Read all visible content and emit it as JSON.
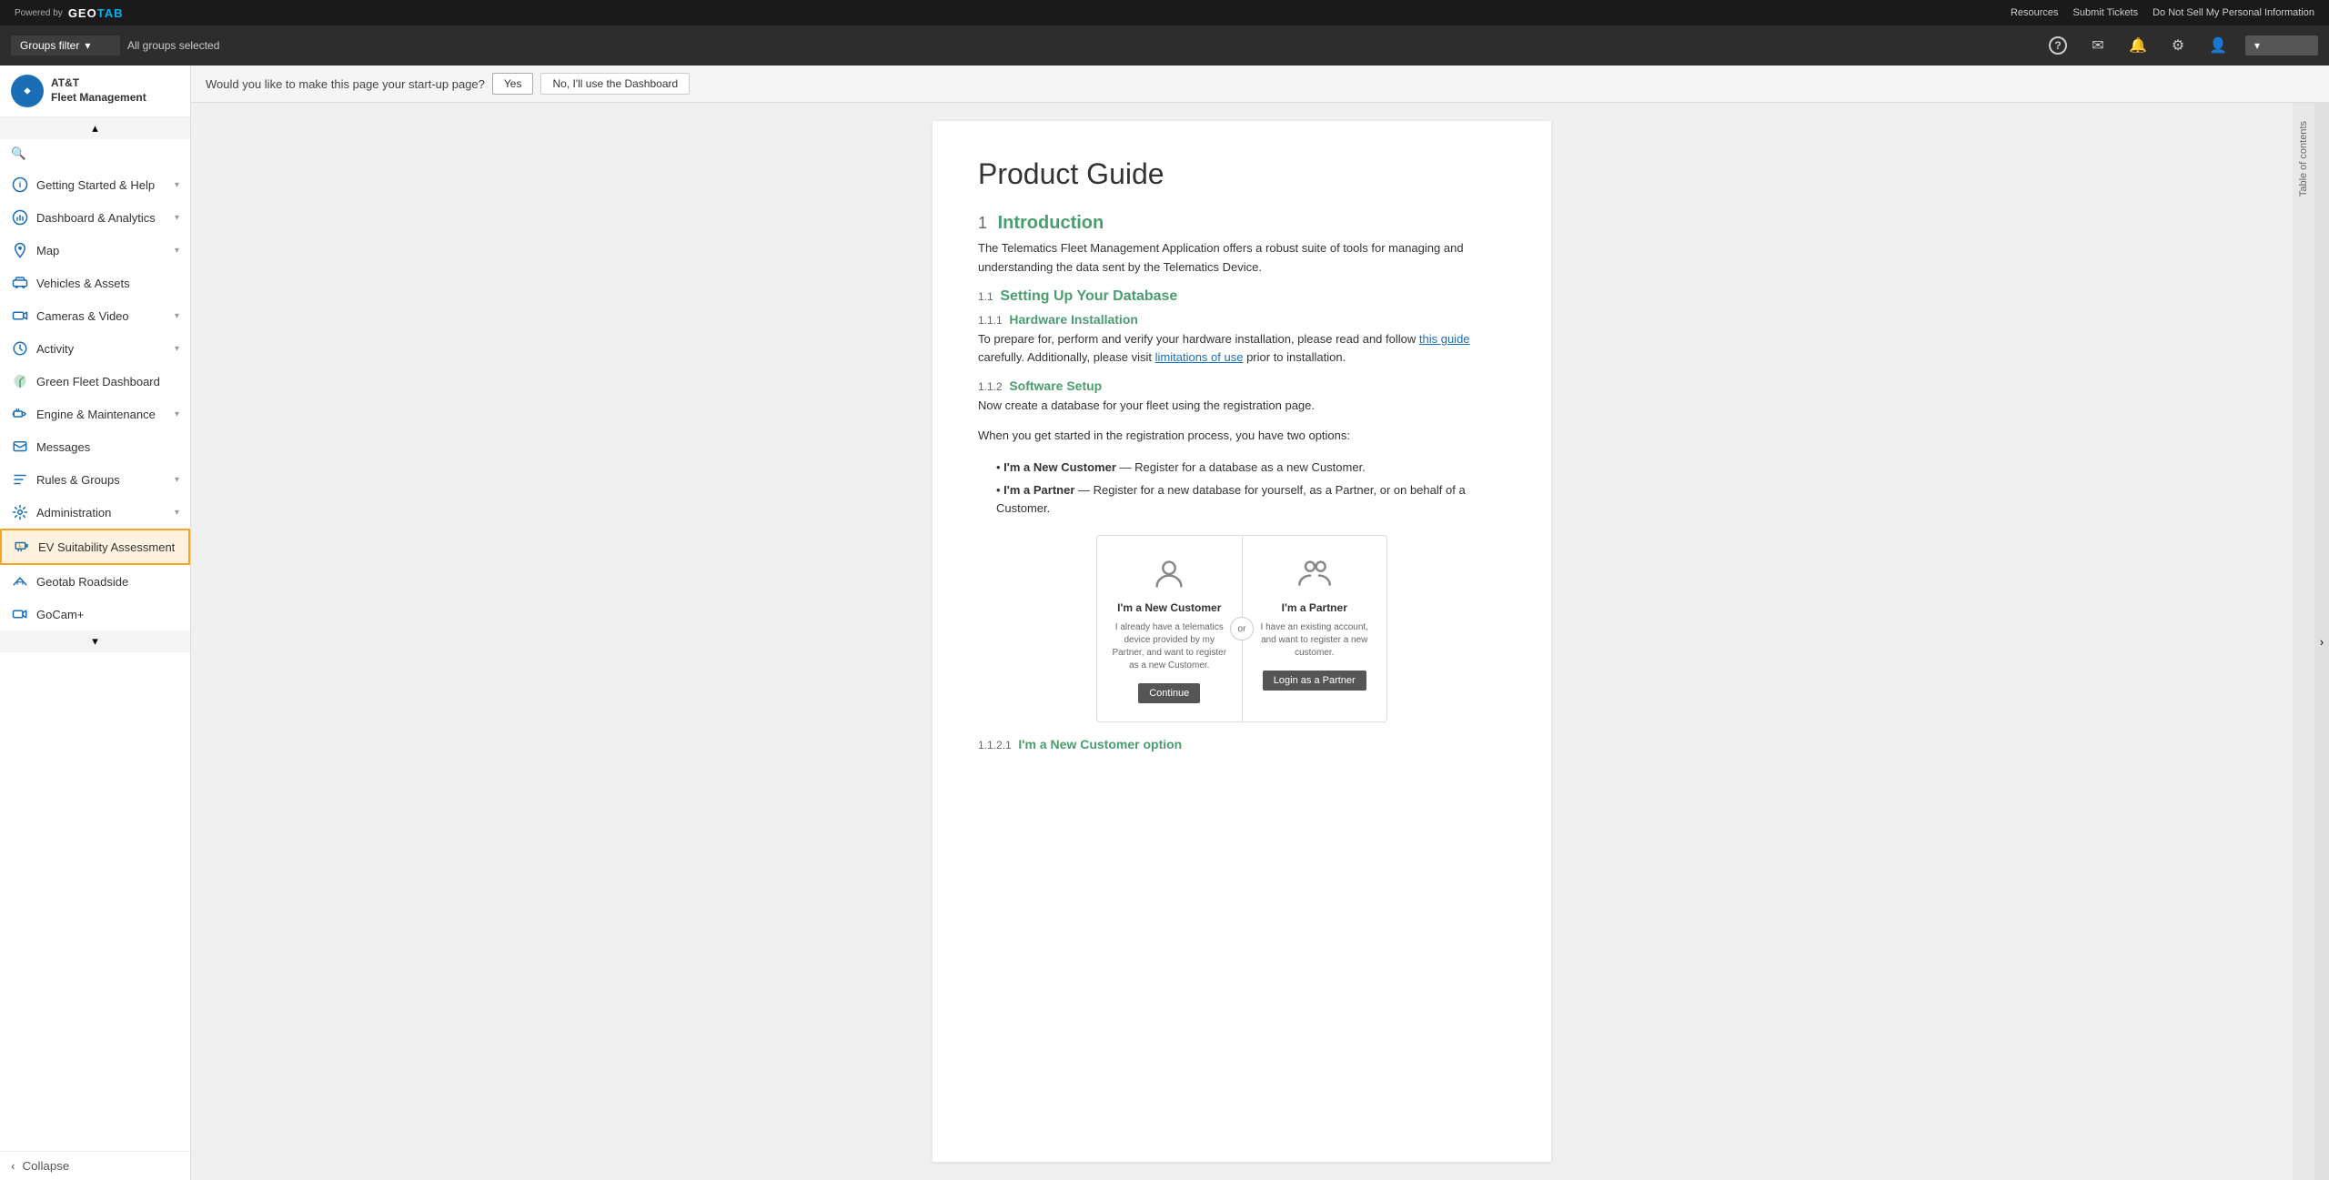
{
  "topbar": {
    "powered_by": "Powered by",
    "logo_text": "GEOTAB",
    "resources": "Resources",
    "submit_tickets": "Submit Tickets",
    "do_not_sell": "Do Not Sell My Personal Information"
  },
  "filterbar": {
    "groups_filter": "Groups filter",
    "all_groups": "All groups selected"
  },
  "sidebar": {
    "brand_line1": "AT&T",
    "brand_line2": "Fleet Management",
    "search_placeholder": "Search",
    "items": [
      {
        "id": "getting-started",
        "label": "Getting Started & Help",
        "icon": "circle-info",
        "has_chevron": true,
        "active": false
      },
      {
        "id": "dashboard",
        "label": "Dashboard & Analytics",
        "icon": "chart-bar",
        "has_chevron": true,
        "active": false
      },
      {
        "id": "map",
        "label": "Map",
        "icon": "map",
        "has_chevron": true,
        "active": false
      },
      {
        "id": "vehicles",
        "label": "Vehicles & Assets",
        "icon": "truck",
        "has_chevron": false,
        "active": false
      },
      {
        "id": "cameras",
        "label": "Cameras & Video",
        "icon": "camera",
        "has_chevron": true,
        "active": false
      },
      {
        "id": "activity",
        "label": "Activity",
        "icon": "clock",
        "has_chevron": true,
        "active": false
      },
      {
        "id": "green-fleet",
        "label": "Green Fleet Dashboard",
        "icon": "leaf",
        "has_chevron": false,
        "active": false
      },
      {
        "id": "engine",
        "label": "Engine & Maintenance",
        "icon": "wrench",
        "has_chevron": true,
        "active": false
      },
      {
        "id": "messages",
        "label": "Messages",
        "icon": "envelope",
        "has_chevron": false,
        "active": false
      },
      {
        "id": "rules",
        "label": "Rules & Groups",
        "icon": "list",
        "has_chevron": true,
        "active": false
      },
      {
        "id": "administration",
        "label": "Administration",
        "icon": "settings",
        "has_chevron": true,
        "active": false
      },
      {
        "id": "ev-suitability",
        "label": "EV Suitability Assessment",
        "icon": "ev",
        "has_chevron": false,
        "active": true
      },
      {
        "id": "geotab-roadside",
        "label": "Geotab Roadside",
        "icon": "road",
        "has_chevron": false,
        "active": false
      },
      {
        "id": "gocam",
        "label": "GoCam+",
        "icon": "video",
        "has_chevron": false,
        "active": false
      }
    ],
    "collapse_label": "Collapse"
  },
  "startup_bar": {
    "question": "Would you like to make this page your start-up page?",
    "yes_label": "Yes",
    "no_label": "No, I'll use the Dashboard"
  },
  "document": {
    "title": "Product Guide",
    "section1": {
      "number": "1",
      "title": "Introduction",
      "text": "The Telematics Fleet Management Application offers a robust suite of tools for managing and understanding the data sent by the Telematics Device."
    },
    "section1_1": {
      "number": "1.1",
      "title": "Setting Up Your Database"
    },
    "section1_1_1": {
      "number": "1.1.1",
      "title": "Hardware Installation",
      "text": "To prepare for, perform and verify your hardware installation, please read and follow ",
      "link1": "this guide",
      "text2": " carefully. Additionally, please visit ",
      "link2": "limitations of use",
      "text3": " prior to installation."
    },
    "section1_1_2": {
      "number": "1.1.2",
      "title": "Software Setup",
      "text1": "Now create a database for your fleet using the registration page.",
      "text2": "When you get started in the registration process, you have two options:",
      "bullet1_bold": "I'm a New Customer",
      "bullet1_text": " — Register for a database as a new Customer.",
      "bullet2_bold": "I'm a Partner",
      "bullet2_text": " — Register for a new database for yourself, as a Partner, or on behalf of a Customer."
    },
    "cards": {
      "card1_title": "I'm a New Customer",
      "card1_desc": "I already have a telematics device provided by my Partner, and want to register as a new Customer.",
      "card1_btn": "Continue",
      "or_text": "or",
      "card2_title": "I'm a Partner",
      "card2_desc": "I have an existing account, and want to register a new customer.",
      "card2_btn": "Login as a Partner"
    },
    "section1_1_2_1": {
      "number": "1.1.2.1",
      "title": "I'm a New Customer option"
    }
  },
  "toc": {
    "label": "Table of contents"
  },
  "icons": {
    "search": "🔍",
    "chevron_down": "▾",
    "chevron_right": "›",
    "chevron_left": "‹",
    "question": "?",
    "mail": "✉",
    "bell": "🔔",
    "gear": "⚙",
    "user": "👤",
    "scroll_down": "▾",
    "scroll_up": "▴"
  }
}
